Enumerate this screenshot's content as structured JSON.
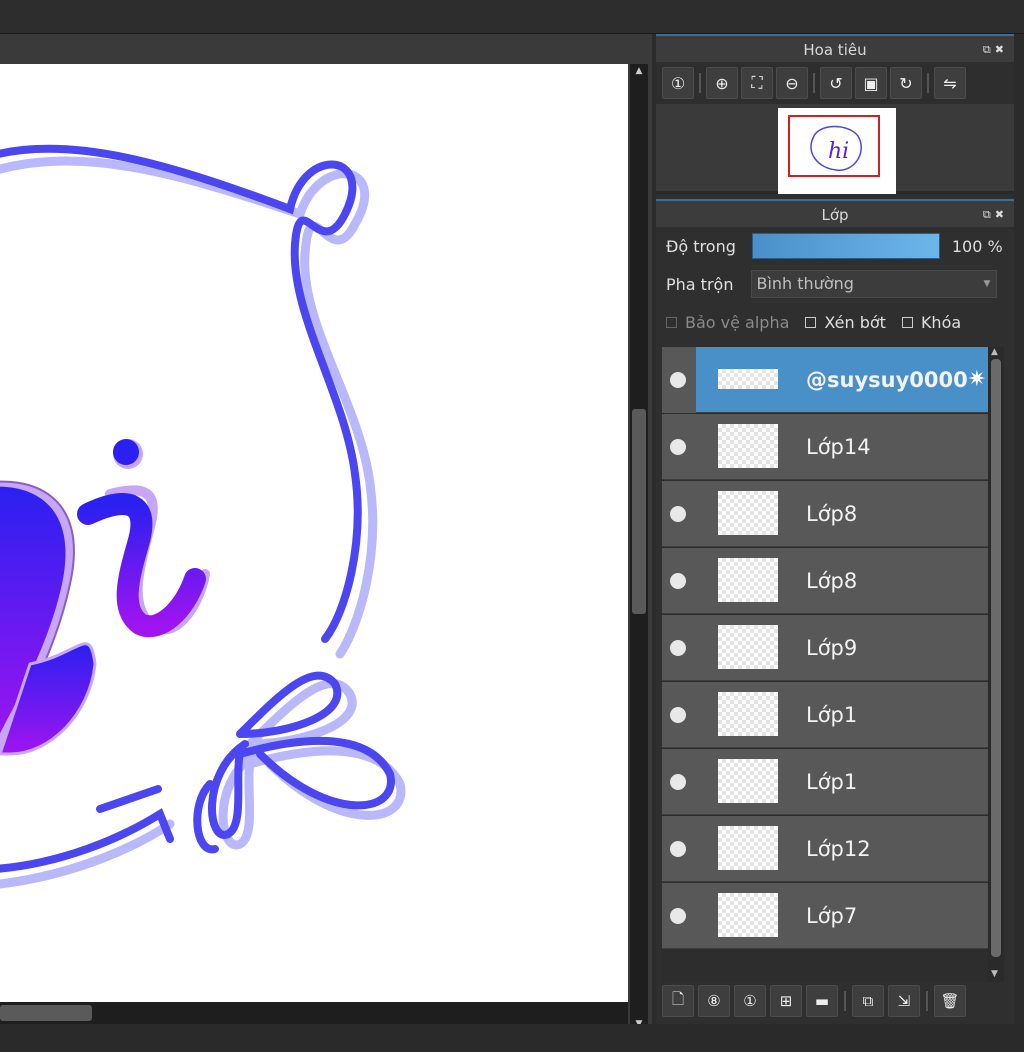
{
  "navigator": {
    "title": "Hoa tiêu",
    "toolbar_icons": [
      "zoom-actual-icon",
      "zoom-in-icon",
      "fit-screen-icon",
      "zoom-out-icon",
      "rotate-left-icon",
      "fit-canvas-icon",
      "rotate-right-icon",
      "flip-icon"
    ]
  },
  "layers_panel": {
    "title": "Lớp",
    "opacity_label": "Độ trong",
    "opacity_value": "100 %",
    "opacity_fraction": 1.0,
    "blend_label": "Pha trộn",
    "blend_value": "Bình thường",
    "alpha_protect": "Bảo vệ alpha",
    "clipping": "Xén bớt",
    "lock": "Khóa",
    "layers": [
      {
        "name": "@suysuy0000",
        "selected": true
      },
      {
        "name": "Lớp14",
        "selected": false
      },
      {
        "name": "Lớp8",
        "selected": false
      },
      {
        "name": "Lớp8",
        "selected": false
      },
      {
        "name": "Lớp9",
        "selected": false
      },
      {
        "name": "Lớp1",
        "selected": false
      },
      {
        "name": "Lớp1",
        "selected": false
      },
      {
        "name": "Lớp12",
        "selected": false
      },
      {
        "name": "Lớp7",
        "selected": false
      }
    ],
    "bottom_icons": [
      "new-layer-icon",
      "new-8bit-layer-icon",
      "new-1bit-layer-icon",
      "add-layer-menu-icon",
      "new-folder-icon",
      "duplicate-layer-icon",
      "merge-down-icon",
      "delete-layer-icon"
    ]
  },
  "colors": {
    "accent": "#4a90c8",
    "stroke_blue": "#4b46f0",
    "stroke_shadow": "#b8b8fb",
    "letter_top": "#2a20f0",
    "letter_bottom": "#a014f0"
  }
}
